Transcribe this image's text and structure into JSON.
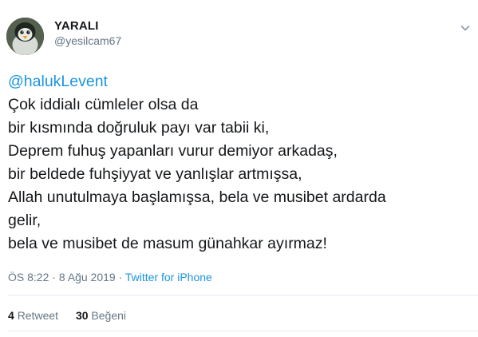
{
  "user": {
    "display_name": "YARALI",
    "handle": "@yesilcam67",
    "avatar_icon": "penguin-avatar-icon"
  },
  "tweet": {
    "mention": "@halukLevent",
    "lines": [
      "Çok iddialı cümleler olsa da",
      "bir kısmında doğruluk payı var tabii ki,",
      "Deprem fuhuş yapanları vurur demiyor arkadaş,",
      "bir beldede fuhşiyyat ve yanlışlar artmışsa,",
      "Allah unutulmaya başlamışsa, bela ve musibet ardarda",
      "gelir,",
      "bela ve musibet de masum günahkar ayırmaz!"
    ]
  },
  "meta": {
    "time": "ÖS 8:22",
    "separator1": " · ",
    "date": "8 Ağu 2019",
    "separator2": " · ",
    "source": "Twitter for iPhone"
  },
  "stats": {
    "retweets_count": "4",
    "retweets_label": "Retweet",
    "likes_count": "30",
    "likes_label": "Beğeni"
  },
  "colors": {
    "link": "#1b95e0",
    "secondary_text": "#657786",
    "primary_text": "#14171a",
    "divider": "#e6ecf0"
  }
}
